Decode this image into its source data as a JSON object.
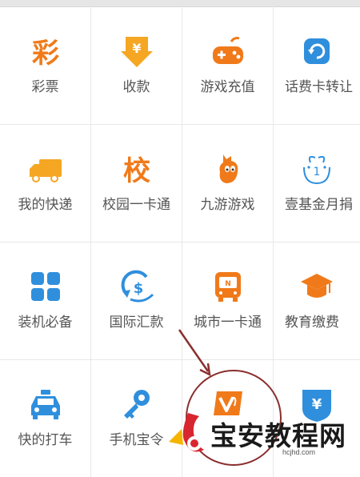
{
  "colors": {
    "accent_orange": "#f07a1a",
    "accent_blue": "#2f8fdd",
    "watermark_red": "#d8262f",
    "annotation": "#8a2e2e"
  },
  "grid": {
    "rows": [
      {
        "cells": [
          {
            "label": "彩票",
            "icon": "lottery-icon"
          },
          {
            "label": "收款",
            "icon": "receive-money-icon"
          },
          {
            "label": "游戏充值",
            "icon": "gamepad-icon"
          },
          {
            "label": "话费卡转让",
            "icon": "phone-card-transfer-icon"
          }
        ]
      },
      {
        "cells": [
          {
            "label": "我的快递",
            "icon": "delivery-truck-icon"
          },
          {
            "label": "校园一卡通",
            "icon": "campus-card-icon"
          },
          {
            "label": "九游游戏",
            "icon": "jiuyou-game-icon"
          },
          {
            "label": "壹基金月捐",
            "icon": "charity-icon"
          }
        ]
      },
      {
        "cells": [
          {
            "label": "装机必备",
            "icon": "app-grid-icon"
          },
          {
            "label": "国际汇款",
            "icon": "international-remittance-icon"
          },
          {
            "label": "城市一卡通",
            "icon": "bus-card-icon"
          },
          {
            "label": "教育缴费",
            "icon": "graduation-cap-icon"
          }
        ]
      },
      {
        "cells": [
          {
            "label": "快的打车",
            "icon": "taxi-icon"
          },
          {
            "label": "手机宝令",
            "icon": "key-icon"
          },
          {
            "label": "",
            "icon": "v-ticket-icon"
          },
          {
            "label": "",
            "icon": "yuan-shield-icon"
          }
        ]
      }
    ]
  },
  "watermark": {
    "text": "宝安教程网",
    "url": "hcjhd.com"
  }
}
